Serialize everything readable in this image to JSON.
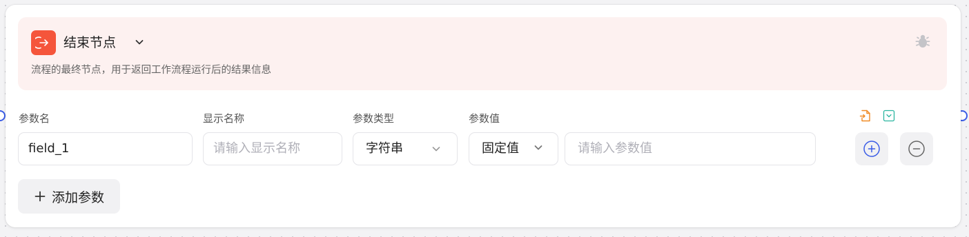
{
  "node": {
    "title": "结束节点",
    "description": "流程的最终节点，用于返回工作流程运行后的结果信息",
    "accent_color": "#f5553b",
    "icon": "exit-arrow-icon"
  },
  "columns": {
    "name": "参数名",
    "display_name": "显示名称",
    "type": "参数类型",
    "value": "参数值"
  },
  "row": {
    "name_value": "field_1",
    "display_name_placeholder": "请输入显示名称",
    "type_selected": "字符串",
    "value_mode_selected": "固定值",
    "value_placeholder": "请输入参数值"
  },
  "actions": {
    "add_param_label": "添加参数"
  },
  "colors": {
    "port": "#3a5ce6",
    "header_bg": "#fdf1f0"
  }
}
